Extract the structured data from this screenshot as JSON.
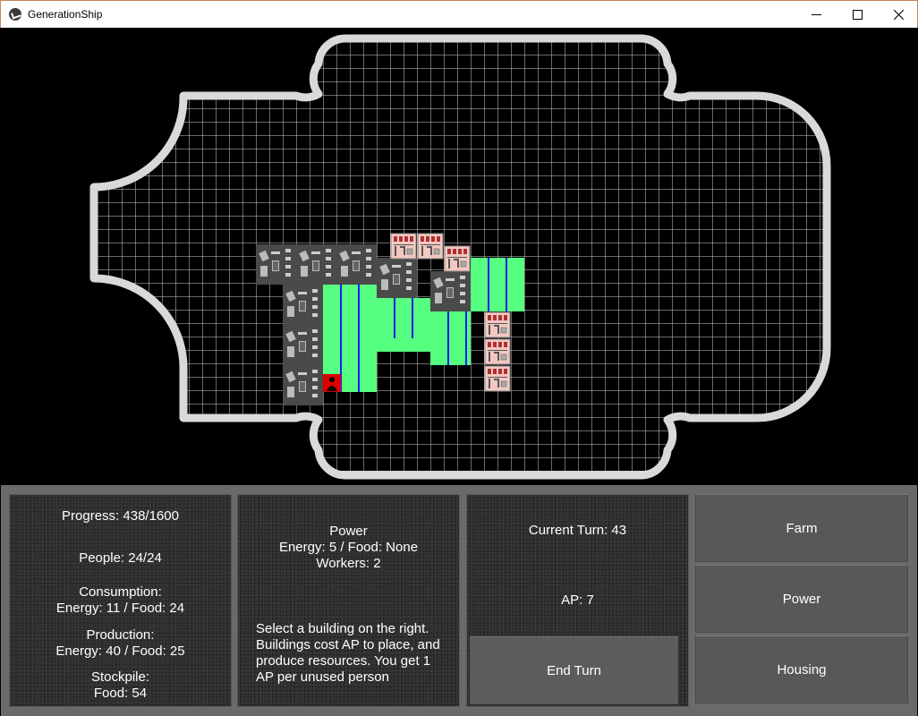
{
  "window": {
    "title": "GenerationShip"
  },
  "stats": {
    "progress": "Progress: 438/1600",
    "people": "People: 24/24",
    "consumption_label": "Consumption:",
    "consumption_value": "Energy: 11 / Food: 24",
    "production_label": "Production:",
    "production_value": "Energy: 40 / Food: 25",
    "stockpile_label": "Stockpile:",
    "stockpile_value": "Food: 54"
  },
  "selected_building": {
    "name": "Power",
    "resources": "Energy: 5 / Food: None",
    "workers": "Workers: 2",
    "help": "Select a building on the right. Buildings cost AP to place, and produce resources. You get 1 AP per unused person"
  },
  "turn": {
    "current": "Current Turn: 43",
    "ap": "AP: 7",
    "end_turn_label": "End Turn"
  },
  "build_menu": {
    "farm_label": "Farm",
    "power_label": "Power",
    "housing_label": "Housing"
  },
  "colors": {
    "hull": "#d9d9d9",
    "grid": "#d0d0d0",
    "farm": "#55ff7f",
    "farm_stripe": "#1a1aff",
    "power": "#4a4a4a",
    "housing": "#f2c8c0",
    "person_tile": "#dd0000"
  }
}
